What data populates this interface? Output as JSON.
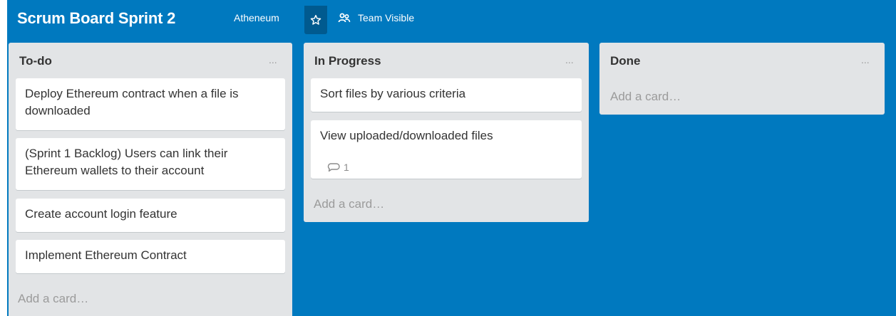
{
  "board": {
    "title": "Scrum Board Sprint 2",
    "organization": "Atheneum",
    "visibility_label": "Team Visible",
    "background_color": "#0079bf"
  },
  "lists": [
    {
      "title": "To-do",
      "menu_label": "...",
      "cards": [
        {
          "text": "Deploy Ethereum contract when a file is downloaded"
        },
        {
          "text": "(Sprint 1 Backlog) Users can link their Ethereum wallets to their account"
        },
        {
          "text": "Create account login feature"
        },
        {
          "text": "Implement Ethereum Contract"
        }
      ],
      "add_card_label": "Add a card…"
    },
    {
      "title": "In Progress",
      "menu_label": "...",
      "cards": [
        {
          "text": "Sort files by various criteria"
        },
        {
          "text": "View uploaded/downloaded files",
          "comment_count": "1"
        }
      ],
      "add_card_label": "Add a card…"
    },
    {
      "title": "Done",
      "menu_label": "...",
      "cards": [],
      "add_card_label": "Add a card…"
    }
  ],
  "icons": {
    "star": "star-icon",
    "visibility": "team-icon",
    "comment": "comment-icon"
  }
}
